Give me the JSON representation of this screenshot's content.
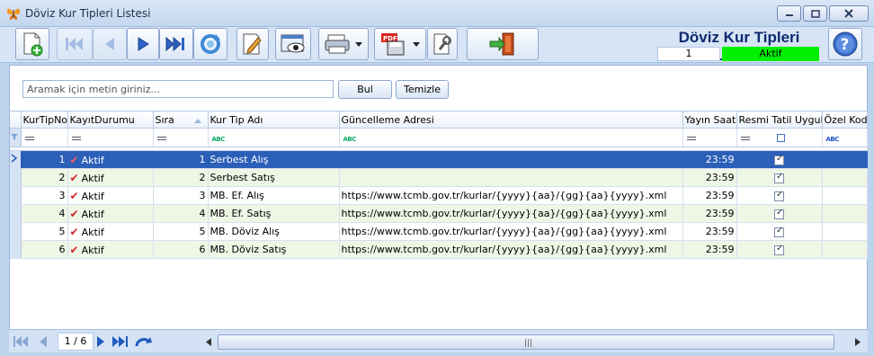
{
  "window": {
    "title": "Döviz Kur Tipleri Listesi"
  },
  "header": {
    "title": "Döviz Kur Tipleri Listesi",
    "count": "1",
    "status": "Aktif",
    "status_color": "#00f000"
  },
  "toolbar": {
    "icons": [
      "new-document-icon",
      "first-record-icon",
      "previous-record-icon",
      "next-record-icon",
      "last-record-icon",
      "refresh-icon",
      "edit-icon",
      "preview-icon",
      "print-icon",
      "export-pdf-icon",
      "settings-icon",
      "exit-icon",
      "help-icon"
    ]
  },
  "search": {
    "placeholder": "Aramak için metin giriniz...",
    "find_label": "Bul",
    "clear_label": "Temizle"
  },
  "grid": {
    "columns": [
      "KurTipNo",
      "KayıtDurumu",
      "Sıra",
      "Kur Tip Adı",
      "Güncelleme Adresi",
      "Yayın Saati",
      "Resmi Tatil Uygula",
      "Özel Kod"
    ],
    "rows": [
      {
        "no": "1",
        "status": "Aktif",
        "order": "1",
        "name": "Serbest Alış",
        "url": "",
        "time": "23:59",
        "holiday": true,
        "code": ""
      },
      {
        "no": "2",
        "status": "Aktif",
        "order": "2",
        "name": "Serbest Satış",
        "url": "",
        "time": "23:59",
        "holiday": true,
        "code": ""
      },
      {
        "no": "3",
        "status": "Aktif",
        "order": "3",
        "name": "MB. Ef. Alış",
        "url": "https://www.tcmb.gov.tr/kurlar/{yyyy}{aa}/{gg}{aa}{yyyy}.xml",
        "time": "23:59",
        "holiday": true,
        "code": ""
      },
      {
        "no": "4",
        "status": "Aktif",
        "order": "4",
        "name": "MB. Ef. Satış",
        "url": "https://www.tcmb.gov.tr/kurlar/{yyyy}{aa}/{gg}{aa}{yyyy}.xml",
        "time": "23:59",
        "holiday": true,
        "code": ""
      },
      {
        "no": "5",
        "status": "Aktif",
        "order": "5",
        "name": "MB. Döviz Alış",
        "url": "https://www.tcmb.gov.tr/kurlar/{yyyy}{aa}/{gg}{aa}{yyyy}.xml",
        "time": "23:59",
        "holiday": true,
        "code": ""
      },
      {
        "no": "6",
        "status": "Aktif",
        "order": "6",
        "name": "MB. Döviz Satış",
        "url": "https://www.tcmb.gov.tr/kurlar/{yyyy}{aa}/{gg}{aa}{yyyy}.xml",
        "time": "23:59",
        "holiday": true,
        "code": ""
      }
    ],
    "selected_row": 0
  },
  "navigator": {
    "page": "1 / 6"
  }
}
